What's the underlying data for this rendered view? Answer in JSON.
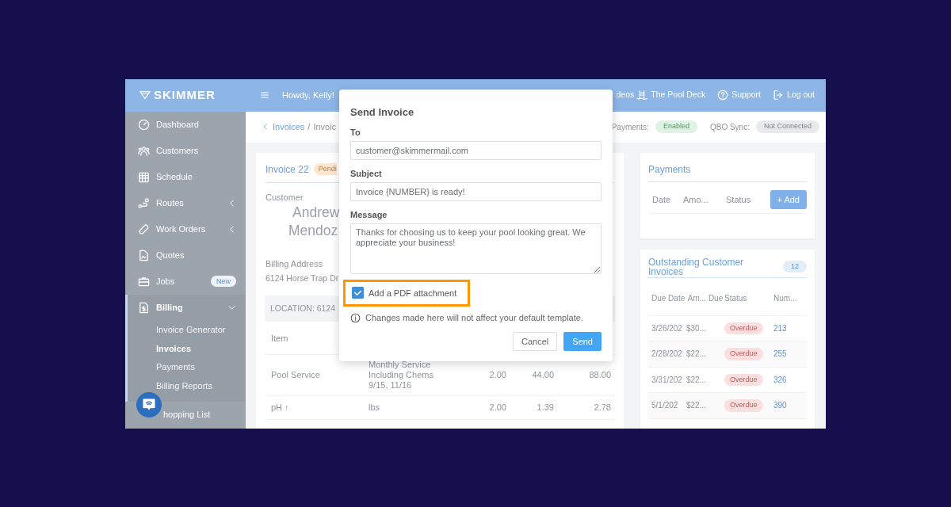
{
  "logo": "SKIMMER",
  "sidebar": {
    "items": [
      {
        "label": "Dashboard",
        "kind": "link",
        "selected": false
      },
      {
        "label": "Customers",
        "kind": "link",
        "selected": false
      },
      {
        "label": "Schedule",
        "kind": "link",
        "selected": false
      },
      {
        "label": "Routes",
        "kind": "group",
        "expanded": false,
        "selected": false
      },
      {
        "label": "Work Orders",
        "kind": "group",
        "expanded": false,
        "selected": false
      },
      {
        "label": "Quotes",
        "kind": "link",
        "selected": false
      },
      {
        "label": "Jobs",
        "kind": "link",
        "badge": "New",
        "selected": false
      },
      {
        "label": "Billing",
        "kind": "group",
        "expanded": true,
        "selected": true,
        "children": [
          {
            "label": "Invoice Generator",
            "selected": false
          },
          {
            "label": "Invoices",
            "selected": true
          },
          {
            "label": "Payments",
            "selected": false
          },
          {
            "label": "Billing Reports",
            "selected": false
          }
        ]
      },
      {
        "label": "hopping List",
        "kind": "link",
        "selected": false
      }
    ]
  },
  "topbar": {
    "greeting": "Howdy, Kelly!",
    "links": [
      {
        "label": "deos"
      },
      {
        "label": "The Pool Deck"
      },
      {
        "label": "Support"
      },
      {
        "label": "Log out"
      }
    ]
  },
  "breadcrumb": {
    "items": [
      "Invoices",
      "Invoic"
    ],
    "separator": "/"
  },
  "statuses": [
    {
      "label": "Payments:",
      "value": "Enabled",
      "kind": "success"
    },
    {
      "label": "QBO Sync:",
      "value": "Not Connected",
      "kind": "neutral"
    }
  ],
  "invoice": {
    "title": "Invoice 22",
    "status": "Pendi",
    "customer_label": "Customer",
    "customer_name": [
      "Andrew",
      "Mendoz"
    ],
    "billing_label": "Billing Address",
    "billing_address": "6124 Horse Trap Dr",
    "location": "LOCATION: 6124",
    "table": {
      "columns": [
        "Item"
      ],
      "rows": [
        [
          "Pool Service",
          "Monthly Service\nIncluding Chems\n9/15, 11/16",
          "2.00",
          "44.00",
          "88.00"
        ],
        [
          "pH ↑",
          "lbs",
          "2.00",
          "1.39",
          "2.78"
        ]
      ]
    }
  },
  "payments": {
    "title": "Payments",
    "columns": [
      "Date",
      "Amo...",
      "Status"
    ],
    "add_button": "+ Add"
  },
  "outstanding": {
    "title": "Outstanding Customer Invoices",
    "count": "12",
    "columns": [
      "Due Date",
      "Am... Due",
      "Status",
      "Num..."
    ],
    "rows": [
      {
        "due": "3/26/202",
        "amount": "$30...",
        "status": "Overdue",
        "number": "213"
      },
      {
        "due": "2/28/202",
        "amount": "$22...",
        "status": "Overdue",
        "number": "255"
      },
      {
        "due": "3/31/202",
        "amount": "$22...",
        "status": "Overdue",
        "number": "326"
      },
      {
        "due": "5/1/202",
        "amount": "$22...",
        "status": "Overdue",
        "number": "390"
      }
    ]
  },
  "dialog": {
    "title": "Send Invoice",
    "fields": [
      {
        "label": "To",
        "value": "customer@skimmermail.com",
        "kind": "input"
      },
      {
        "label": "Subject",
        "value": "Invoice {NUMBER} is ready!",
        "kind": "input"
      },
      {
        "label": "Message",
        "value": "Thanks for choosing us to keep your pool looking great. We appreciate your business!",
        "kind": "textarea"
      }
    ],
    "attachment": {
      "label": "Add a PDF attachment",
      "checked": true,
      "highlighted": true
    },
    "note": "Changes made here will not affect your default template.",
    "buttons": [
      {
        "label": "Cancel",
        "kind": "secondary"
      },
      {
        "label": "Send",
        "kind": "primary"
      }
    ]
  }
}
